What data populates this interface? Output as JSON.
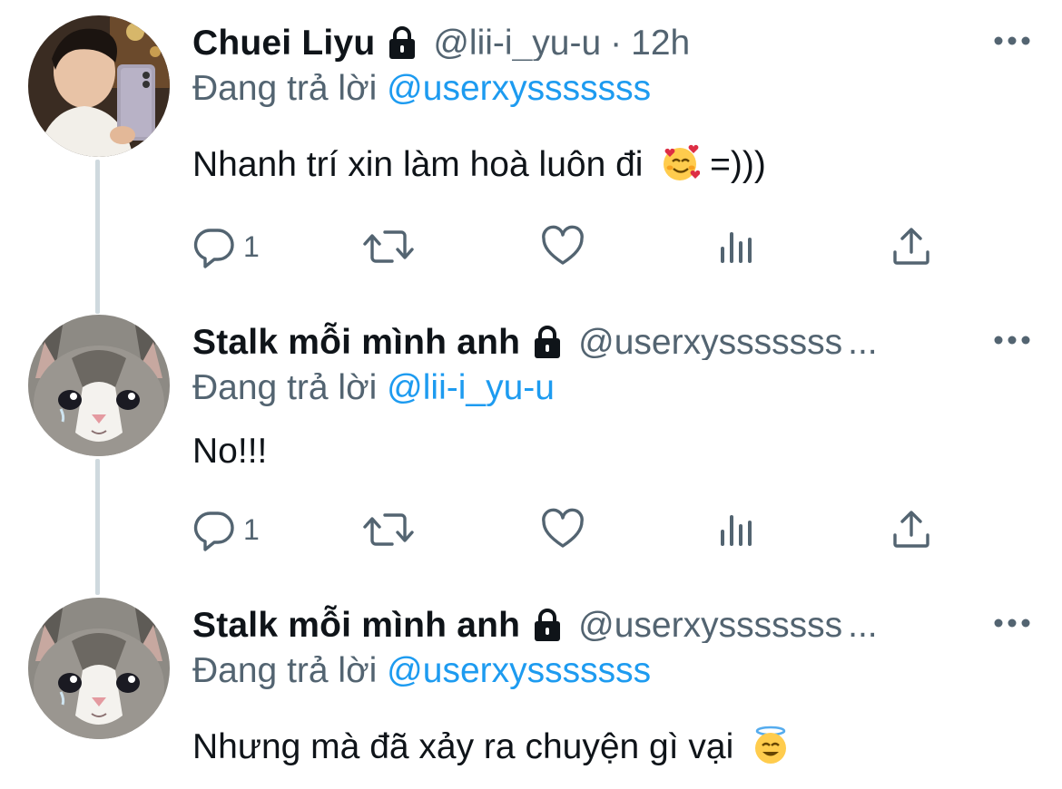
{
  "colors": {
    "text": "#0f1419",
    "secondary": "#536471",
    "accent": "#1d9bf0",
    "connector": "#cfd9de"
  },
  "tweets": [
    {
      "name": "Chuei Liyu",
      "handle": "@lii-i_yu-u",
      "time_sep": "·",
      "time": "12h",
      "reply_prefix": "Đang trả lời",
      "reply_mention": "@userxysssssss",
      "text": "Nhanh trí xin làm hoà luôn đi",
      "text_suffix": "=)))",
      "emoji": "smiling-face-with-hearts",
      "reply_count": "1",
      "avatar": "person-portrait"
    },
    {
      "name": "Stalk mỗi mình anh",
      "handle": "@userxysssssss",
      "truncation": "...",
      "reply_prefix": "Đang trả lời",
      "reply_mention": "@lii-i_yu-u",
      "text": "No!!!",
      "reply_count": "1",
      "avatar": "crying-cat"
    },
    {
      "name": "Stalk mỗi mình anh",
      "handle": "@userxysssssss",
      "truncation": "...",
      "reply_prefix": "Đang trả lời",
      "reply_mention": "@userxysssssss",
      "text": "Nhưng mà đã xảy ra chuyện gì vại",
      "emoji": "smiling-face-with-halo",
      "avatar": "crying-cat"
    }
  ],
  "icons": {
    "lock": "lock-icon",
    "more": "more-horizontal-icon",
    "reply": "reply-bubble-icon",
    "retweet": "retweet-icon",
    "like": "heart-icon",
    "analytics": "analytics-bars-icon",
    "share": "share-upload-icon"
  }
}
